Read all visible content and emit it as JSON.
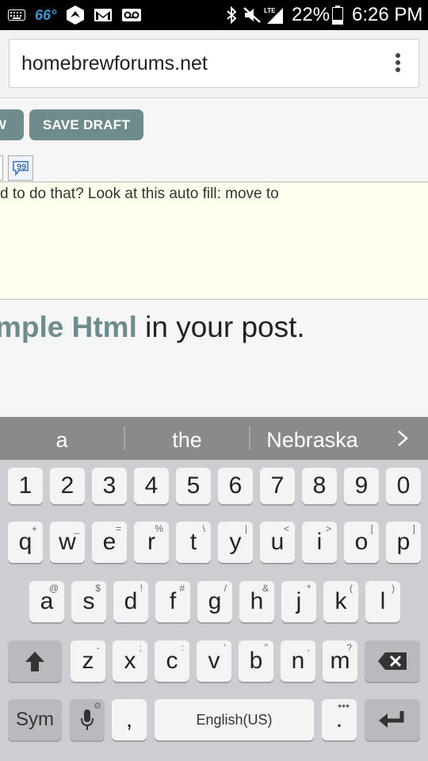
{
  "status_bar": {
    "temperature": "66°",
    "battery_percent": "22%",
    "time": "6:26 PM"
  },
  "browser": {
    "url": "homebrewforums.net"
  },
  "page": {
    "preview_button": "W",
    "save_draft_button": "SAVE DRAFT",
    "editor_text": "d to do that? Look at this auto fill: move to",
    "hint_strong": "mple Html",
    "hint_rest": " in your post."
  },
  "suggestions": [
    "a",
    "the",
    "Nebraska"
  ],
  "keyboard": {
    "row_numbers": [
      "1",
      "2",
      "3",
      "4",
      "5",
      "6",
      "7",
      "8",
      "9",
      "0"
    ],
    "row1": [
      {
        "k": "q",
        "h": "+"
      },
      {
        "k": "w",
        "h": "_"
      },
      {
        "k": "e",
        "h": "="
      },
      {
        "k": "r",
        "h": "%"
      },
      {
        "k": "t",
        "h": "\\"
      },
      {
        "k": "y",
        "h": "|"
      },
      {
        "k": "u",
        "h": "<"
      },
      {
        "k": "i",
        "h": ">"
      },
      {
        "k": "o",
        "h": "["
      },
      {
        "k": "p",
        "h": "]"
      }
    ],
    "row2": [
      {
        "k": "a",
        "h": "@"
      },
      {
        "k": "s",
        "h": "$"
      },
      {
        "k": "d",
        "h": "!"
      },
      {
        "k": "f",
        "h": "#"
      },
      {
        "k": "g",
        "h": "/"
      },
      {
        "k": "h",
        "h": "&"
      },
      {
        "k": "j",
        "h": "*"
      },
      {
        "k": "k",
        "h": "("
      },
      {
        "k": "l",
        "h": ")"
      }
    ],
    "row3": [
      {
        "k": "z",
        "h": "-"
      },
      {
        "k": "x",
        "h": ";"
      },
      {
        "k": "c",
        "h": ":"
      },
      {
        "k": "v",
        "h": "'"
      },
      {
        "k": "b",
        "h": "\""
      },
      {
        "k": "n",
        "h": ","
      },
      {
        "k": "m",
        "h": "?"
      }
    ],
    "sym_label": "Sym",
    "comma_label": ",",
    "space_label": "English(US)",
    "period_label": "."
  }
}
